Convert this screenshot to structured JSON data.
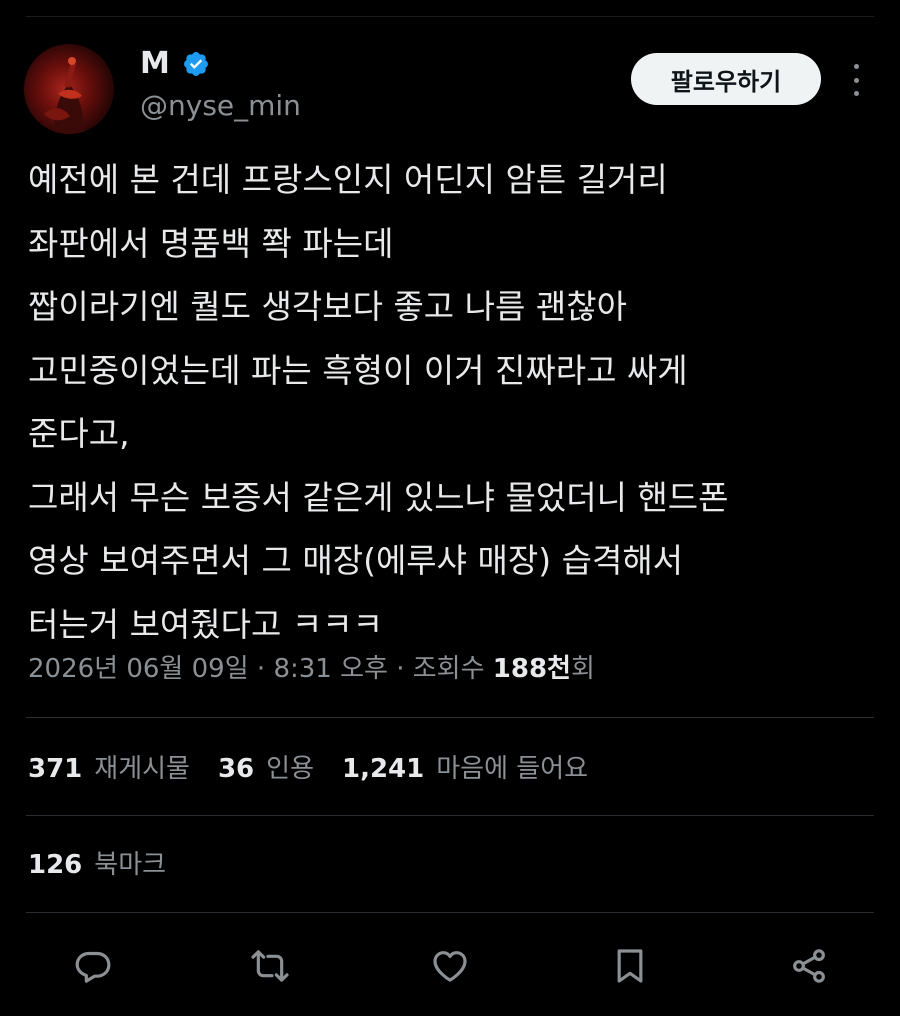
{
  "author": {
    "display_name": "M",
    "handle": "@nyse_min",
    "verified": true
  },
  "follow_button": {
    "label": "팔로우하기"
  },
  "tweet": {
    "lines": [
      "예전에 본 건데 프랑스인지 어딘지 암튼 길거리",
      "좌판에서 명품백 쫙 파는데",
      "짭이라기엔 퀄도 생각보다 좋고 나름 괜찮아",
      "고민중이었는데 파는 흑형이 이거 진짜라고 싸게",
      "준다고,",
      "그래서 무슨 보증서 같은게 있느냐 물었더니 핸드폰",
      "영상 보여주면서 그 매장(에루샤 매장) 습격해서",
      "터는거 보여줬다고 ㅋㅋㅋ"
    ]
  },
  "meta": {
    "date": "2026년 06월 09일",
    "separator": "·",
    "time": "8:31 오후",
    "views_label": "조회수",
    "views_count": "188천",
    "views_suffix": "회"
  },
  "stats": {
    "retweets_count": "371",
    "retweets_label": "재게시물",
    "quotes_count": "36",
    "quotes_label": "인용",
    "likes_count": "1,241",
    "likes_label": "마음에 들어요"
  },
  "bookmarks": {
    "count": "126",
    "label": "북마크"
  },
  "colors": {
    "background": "#000000",
    "text_primary": "#e7e9ea",
    "text_secondary": "#8b9095",
    "verified_blue": "#1d9bf0",
    "follow_button_bg": "#eff3f4",
    "divider": "#2a2e33"
  },
  "icons": {
    "verified": "verified-badge-icon",
    "more": "more-dots-icon",
    "reply": "reply-bubble-icon",
    "retweet": "retweet-icon",
    "like": "heart-icon",
    "bookmark": "bookmark-icon",
    "share": "share-icon"
  }
}
